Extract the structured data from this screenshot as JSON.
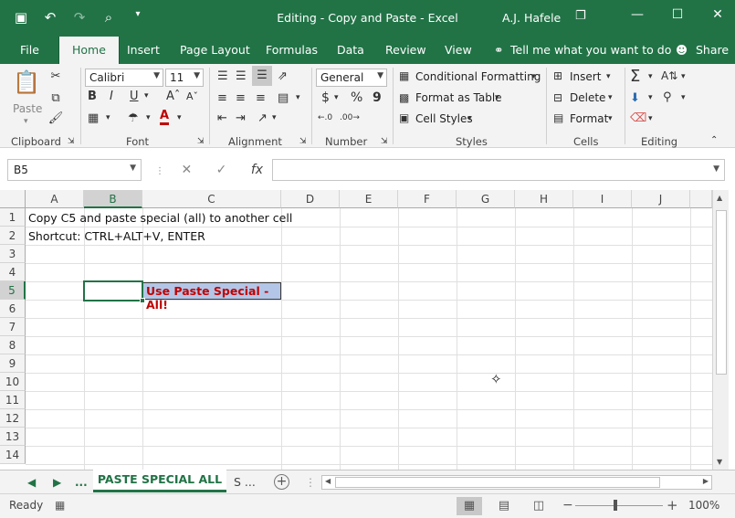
{
  "window": {
    "title": "Editing - Copy and Paste  -  Excel",
    "user": "A.J. Hafele"
  },
  "qat": {
    "save_icon": "▣",
    "undo_icon": "↶",
    "redo_icon": "↷",
    "preview_icon": "⌕",
    "customize_icon": "▾"
  },
  "window_controls": {
    "ribbon_display_icon": "❐",
    "minimize": "—",
    "maximize": "☐",
    "close": "✕"
  },
  "tabs": [
    "File",
    "Home",
    "Insert",
    "Page Layout",
    "Formulas",
    "Data",
    "Review",
    "View"
  ],
  "tell_me": "Tell me what you want to do",
  "share": "Share",
  "ribbon": {
    "clipboard": {
      "label": "Clipboard",
      "paste": "Paste"
    },
    "font": {
      "label": "Font",
      "name": "Calibri",
      "size": "11"
    },
    "alignment": {
      "label": "Alignment"
    },
    "number": {
      "label": "Number",
      "format": "General",
      "currency": "$",
      "percent": "%",
      "comma": "9"
    },
    "styles": {
      "label": "Styles",
      "conditional": "Conditional Formatting",
      "format_table": "Format as Table",
      "cell_styles": "Cell Styles"
    },
    "cells": {
      "label": "Cells",
      "insert": "Insert",
      "delete": "Delete",
      "format": "Format"
    },
    "editing": {
      "label": "Editing"
    }
  },
  "formula_bar": {
    "name_box": "B5",
    "formula": ""
  },
  "columns": [
    "A",
    "B",
    "C",
    "D",
    "E",
    "F",
    "G",
    "H",
    "I",
    "J"
  ],
  "rows": [
    "1",
    "2",
    "3",
    "4",
    "5",
    "6",
    "7",
    "8",
    "9",
    "10",
    "11",
    "12",
    "13",
    "14"
  ],
  "cells": {
    "A1": "Copy C5 and paste special (all) to another cell",
    "A2": "Shortcut: CTRL+ALT+V, ENTER",
    "C5": "Use Paste Special - All!"
  },
  "sheets": {
    "ellipsis_left": "...",
    "active": "PASTE SPECIAL ALL",
    "other": "S  ..."
  },
  "status": {
    "ready": "Ready",
    "zoom": "100%"
  },
  "colors": {
    "accent": "#217346",
    "c5_fill": "#b4c6e7",
    "c5_text": "#c00000"
  }
}
